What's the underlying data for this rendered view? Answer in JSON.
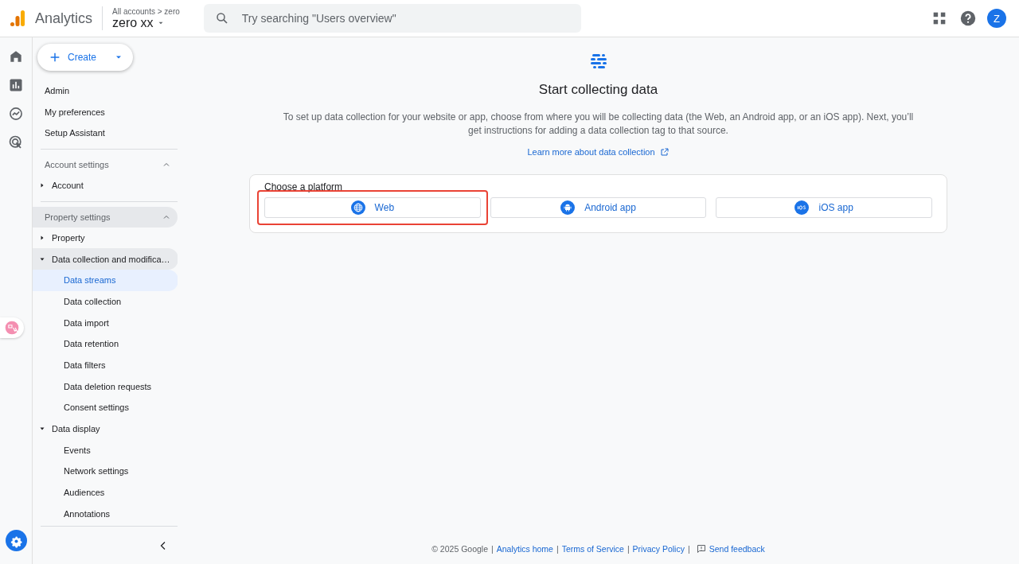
{
  "header": {
    "product": "Analytics",
    "breadcrumb": "All accounts > zero",
    "account": "zero xx",
    "search": {
      "placeholder": "Try searching \"Users overview\""
    },
    "avatar": "Z"
  },
  "rail": [
    {
      "kind": "home",
      "selected": false
    },
    {
      "kind": "reports",
      "selected": false
    },
    {
      "kind": "explore",
      "selected": false
    },
    {
      "kind": "advertising",
      "selected": false
    }
  ],
  "sidebar": {
    "create": "Create",
    "links": [
      {
        "label": "Admin"
      },
      {
        "label": "My preferences"
      },
      {
        "label": "Setup Assistant"
      }
    ],
    "sections": [
      {
        "title": "Account settings",
        "expanded": true,
        "highlighted": false,
        "items": [
          {
            "label": "Account",
            "expanded": false,
            "highlighted": false
          }
        ]
      },
      {
        "title": "Property settings",
        "expanded": true,
        "highlighted": true,
        "items": [
          {
            "label": "Property",
            "expanded": false,
            "highlighted": false
          },
          {
            "label": "Data collection and modifica…",
            "expanded": true,
            "highlighted": true,
            "children": [
              {
                "label": "Data streams",
                "selected": true
              },
              {
                "label": "Data collection",
                "selected": false
              },
              {
                "label": "Data import",
                "selected": false
              },
              {
                "label": "Data retention",
                "selected": false
              },
              {
                "label": "Data filters",
                "selected": false
              },
              {
                "label": "Data deletion requests",
                "selected": false
              },
              {
                "label": "Consent settings",
                "selected": false
              }
            ]
          },
          {
            "label": "Data display",
            "expanded": true,
            "highlighted": false,
            "children": [
              {
                "label": "Events",
                "selected": false
              },
              {
                "label": "Network settings",
                "selected": false
              },
              {
                "label": "Audiences",
                "selected": false
              },
              {
                "label": "Annotations",
                "selected": false
              }
            ]
          }
        ]
      }
    ]
  },
  "main": {
    "title": "Start collecting data",
    "description": "To set up data collection for your website or app, choose from where you will be collecting data (the Web, an Android app, or an iOS app). Next, you’ll get instructions for adding a data collection tag to that source.",
    "learn_more": "Learn more about data collection",
    "platform_heading": "Choose a platform",
    "platforms": [
      {
        "kind": "web",
        "label": "Web",
        "selected": true
      },
      {
        "kind": "android",
        "label": "Android app",
        "selected": false
      },
      {
        "kind": "ios",
        "label": "iOS app",
        "selected": false
      }
    ]
  },
  "footer": {
    "copyright": "© 2025 Google",
    "separator": "|",
    "links": [
      "Analytics home",
      "Terms of Service",
      "Privacy Policy"
    ],
    "feedback": "Send feedback"
  }
}
